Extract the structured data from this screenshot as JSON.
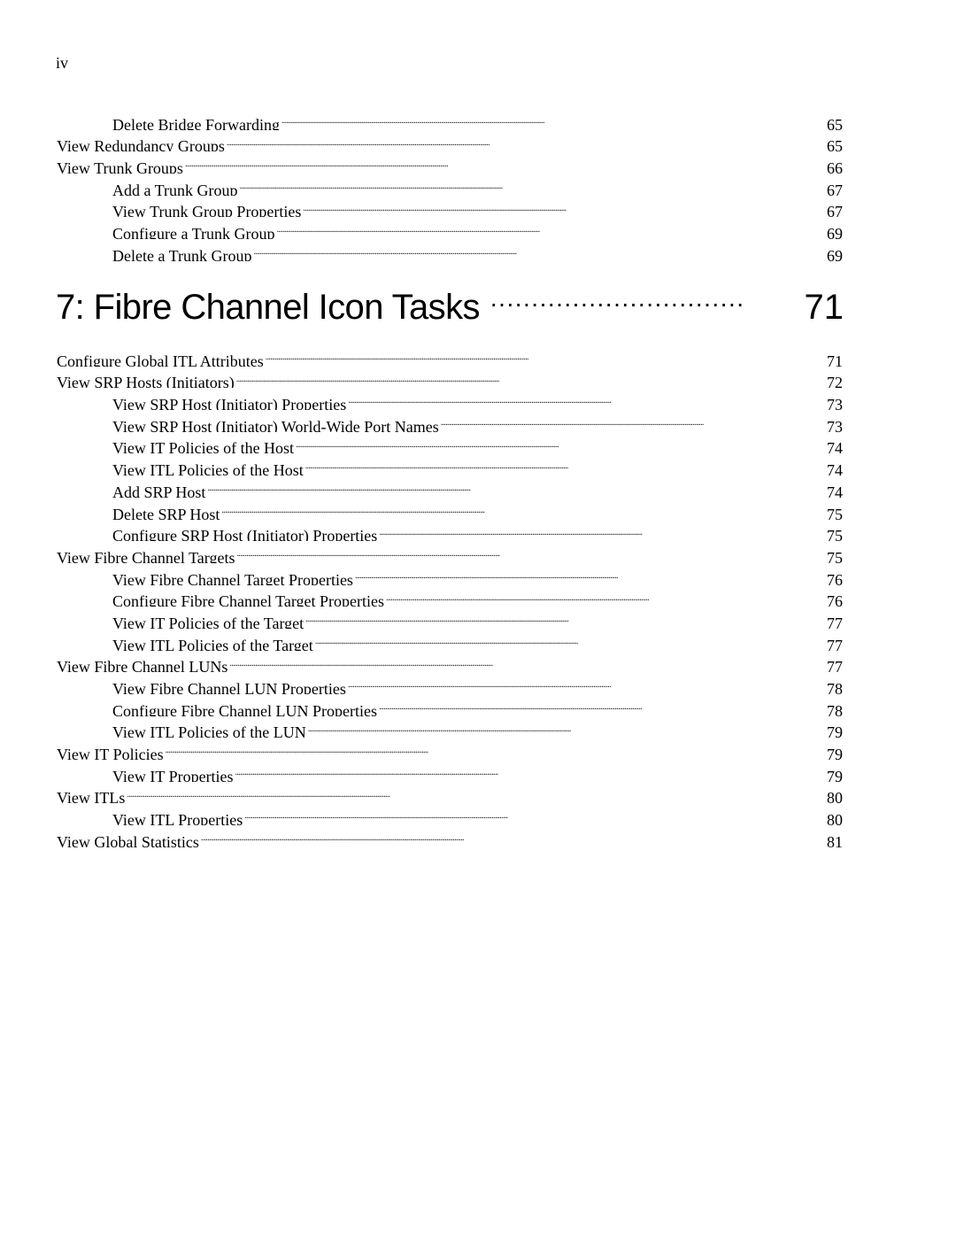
{
  "page_number": "iv",
  "toc_top": [
    {
      "label": "Delete Bridge Forwarding",
      "page": "65",
      "level": 2
    },
    {
      "label": "View Redundancy Groups",
      "page": "65",
      "level": 1
    },
    {
      "label": "View Trunk Groups",
      "page": "66",
      "level": 1
    },
    {
      "label": "Add a Trunk Group",
      "page": "67",
      "level": 2
    },
    {
      "label": "View Trunk Group Properties",
      "page": "67",
      "level": 2
    },
    {
      "label": "Configure a Trunk Group",
      "page": "69",
      "level": 2
    },
    {
      "label": "Delete a Trunk Group",
      "page": "69",
      "level": 2
    }
  ],
  "chapter": {
    "title": "7: Fibre Channel Icon Tasks",
    "page": "71"
  },
  "toc_chapter": [
    {
      "label": "Configure Global ITL Attributes",
      "page": "71",
      "level": 1
    },
    {
      "label": "View SRP Hosts (Initiators)",
      "page": "72",
      "level": 1
    },
    {
      "label": "View SRP Host (Initiator) Properties",
      "page": "73",
      "level": 2
    },
    {
      "label": "View SRP Host (Initiator) World-Wide Port Names",
      "page": "73",
      "level": 2
    },
    {
      "label": "View IT Policies of the Host",
      "page": "74",
      "level": 2
    },
    {
      "label": "View ITL Policies of the Host",
      "page": "74",
      "level": 2
    },
    {
      "label": "Add SRP Host",
      "page": "74",
      "level": 2
    },
    {
      "label": "Delete SRP Host",
      "page": "75",
      "level": 2
    },
    {
      "label": "Configure SRP Host (Initiator) Properties",
      "page": "75",
      "level": 2
    },
    {
      "label": "View Fibre Channel Targets",
      "page": "75",
      "level": 1
    },
    {
      "label": "View Fibre Channel Target Properties",
      "page": "76",
      "level": 2
    },
    {
      "label": "Configure Fibre Channel Target Properties",
      "page": "76",
      "level": 2
    },
    {
      "label": "View IT Policies of the Target",
      "page": "77",
      "level": 2
    },
    {
      "label": "View ITL Policies of the Target",
      "page": "77",
      "level": 2
    },
    {
      "label": "View Fibre Channel LUNs",
      "page": "77",
      "level": 1
    },
    {
      "label": "View Fibre Channel LUN Properties",
      "page": "78",
      "level": 2
    },
    {
      "label": "Configure Fibre Channel LUN Properties",
      "page": "78",
      "level": 2
    },
    {
      "label": "View ITL Policies of the LUN",
      "page": "79",
      "level": 2
    },
    {
      "label": "View IT Policies",
      "page": "79",
      "level": 1
    },
    {
      "label": "View IT Properties",
      "page": "79",
      "level": 2
    },
    {
      "label": "View ITLs",
      "page": "80",
      "level": 1
    },
    {
      "label": "View ITL Properties",
      "page": "80",
      "level": 2
    },
    {
      "label": "View Global Statistics",
      "page": "81",
      "level": 1
    }
  ]
}
